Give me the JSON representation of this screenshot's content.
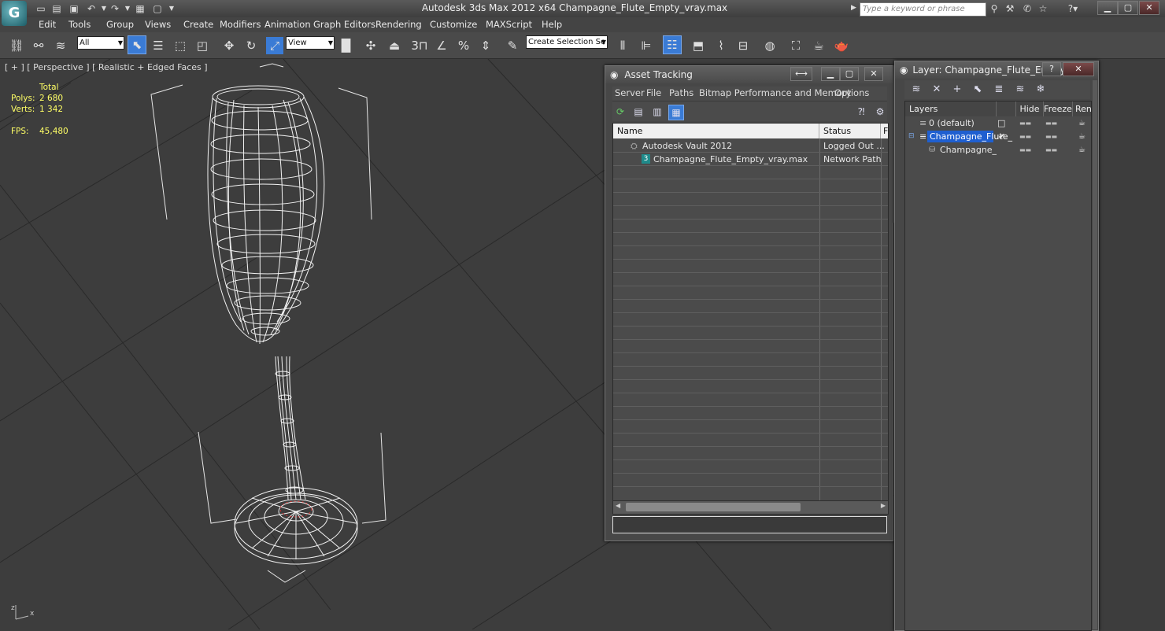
{
  "window": {
    "title": "Autodesk 3ds Max  2012 x64     Champagne_Flute_Empty_vray.max",
    "search_placeholder": "Type a keyword or phrase"
  },
  "menu": [
    "Edit",
    "Tools",
    "Group",
    "Views",
    "Create",
    "Modifiers",
    "Animation",
    "Graph Editors",
    "Rendering",
    "Customize",
    "MAXScript",
    "Help"
  ],
  "toolbar": {
    "selection_filter": "All",
    "ref_coord": "View",
    "named_selection": "Create Selection Se"
  },
  "viewport": {
    "label": "[ + ] [ Perspective ] [ Realistic + Edged Faces ]",
    "stats": {
      "total_label": "Total",
      "polys_label": "Polys:",
      "polys_value": "2 680",
      "verts_label": "Verts:",
      "verts_value": "1 342",
      "fps_label": "FPS:",
      "fps_value": "45,480"
    }
  },
  "asset_tracking": {
    "title": "Asset Tracking",
    "menu": [
      "Server",
      "File",
      "Paths",
      "Bitmap Performance and Memory",
      "Options"
    ],
    "columns": {
      "name": "Name",
      "status": "Status",
      "extra": "F"
    },
    "rows": [
      {
        "name": "Autodesk Vault 2012",
        "status": "Logged Out ..."
      },
      {
        "name": "Champagne_Flute_Empty_vray.max",
        "status": "Network Path"
      }
    ]
  },
  "layer_manager": {
    "title": "Layer: Champagne_Flute_Empty",
    "columns": {
      "layers": "Layers",
      "hide": "Hide",
      "freeze": "Freeze",
      "render": "Rende"
    },
    "rows": [
      {
        "name": "0 (default)"
      },
      {
        "name": "Champagne_Flute_"
      },
      {
        "name": "Champagne_Flut"
      }
    ]
  },
  "colors": {
    "accent": "#3a7bd5",
    "stats_text": "#ffff66",
    "viewport_bg": "#3d3d3d"
  }
}
